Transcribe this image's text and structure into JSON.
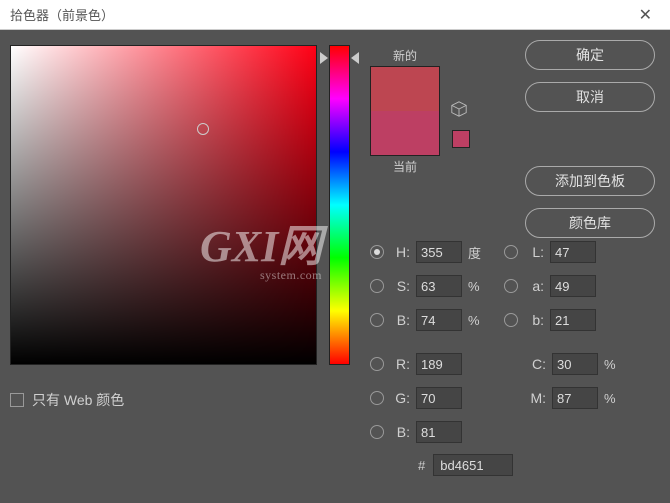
{
  "titlebar": {
    "title": "拾色器（前景色）"
  },
  "labels": {
    "new": "新的",
    "current": "当前",
    "web_only": "只有 Web 颜色"
  },
  "buttons": {
    "ok": "确定",
    "cancel": "取消",
    "add_swatch": "添加到色板",
    "libraries": "颜色库"
  },
  "hsb": {
    "h_label": "H:",
    "h_value": "355",
    "h_unit": "度",
    "s_label": "S:",
    "s_value": "63",
    "s_unit": "%",
    "b_label": "B:",
    "b_value": "74",
    "b_unit": "%"
  },
  "lab": {
    "l_label": "L:",
    "l_value": "47",
    "a_label": "a:",
    "a_value": "49",
    "b_label": "b:",
    "b_value": "21"
  },
  "rgb": {
    "r_label": "R:",
    "r_value": "189",
    "g_label": "G:",
    "g_value": "70",
    "b_label": "B:",
    "b_value": "81"
  },
  "cmyk": {
    "c_label": "C:",
    "c_value": "30",
    "c_unit": "%",
    "m_label": "M:",
    "m_value": "87",
    "m_unit": "%"
  },
  "hex": {
    "prefix": "#",
    "value": "bd4651"
  },
  "colors": {
    "new": "#bd4651",
    "current": "#bd3f63"
  },
  "watermark": {
    "big": "GXI网",
    "small": "system.com"
  }
}
